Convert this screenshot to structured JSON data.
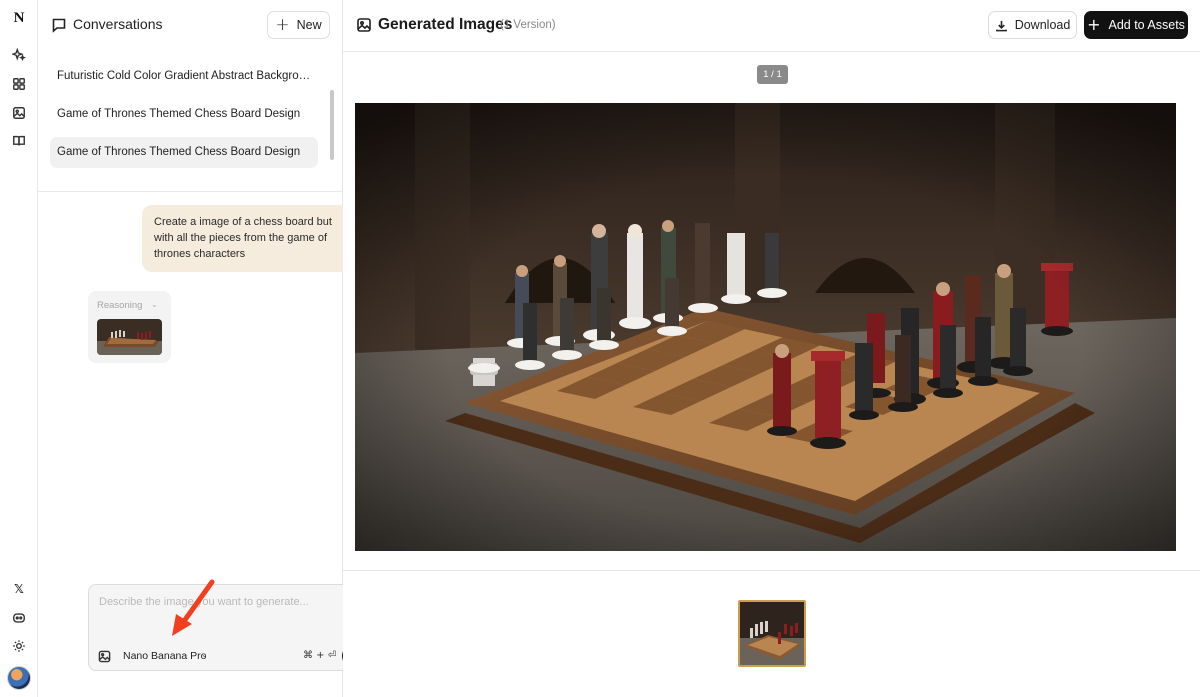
{
  "rail": {
    "logo": "N",
    "icons": [
      "sparkles-icon",
      "grid-icon",
      "image-gallery-icon",
      "book-icon",
      "x-logo-icon",
      "discord-icon",
      "sun-icon"
    ],
    "x_glyph": "𝕏"
  },
  "conversations": {
    "title": "Conversations",
    "new_label": "New",
    "items": [
      {
        "label": "Futuristic Cold Color Gradient Abstract Background…"
      },
      {
        "label": "Game of Thrones Themed Chess Board Design"
      },
      {
        "label": "Game of Thrones Themed Chess Board Design"
      }
    ]
  },
  "chat": {
    "user_message": "Create a image of a chess board but with all the pieces from the game of thrones characters",
    "reasoning_label": "Reasoning"
  },
  "composer": {
    "placeholder": "Describe the image you want to generate...",
    "model": "Nano Banana Pro",
    "shortcut": "⌘ + ⏎"
  },
  "main": {
    "title": "Generated Images",
    "version": "(1 Version)",
    "download_label": "Download",
    "add_label": "Add to Assets",
    "pager": "1 / 1"
  },
  "colors": {
    "accent": "#111111",
    "user_bubble": "#f5ecdd",
    "annotation_arrow": "#f0401f",
    "selected_thumb_border": "#c8a04b"
  }
}
